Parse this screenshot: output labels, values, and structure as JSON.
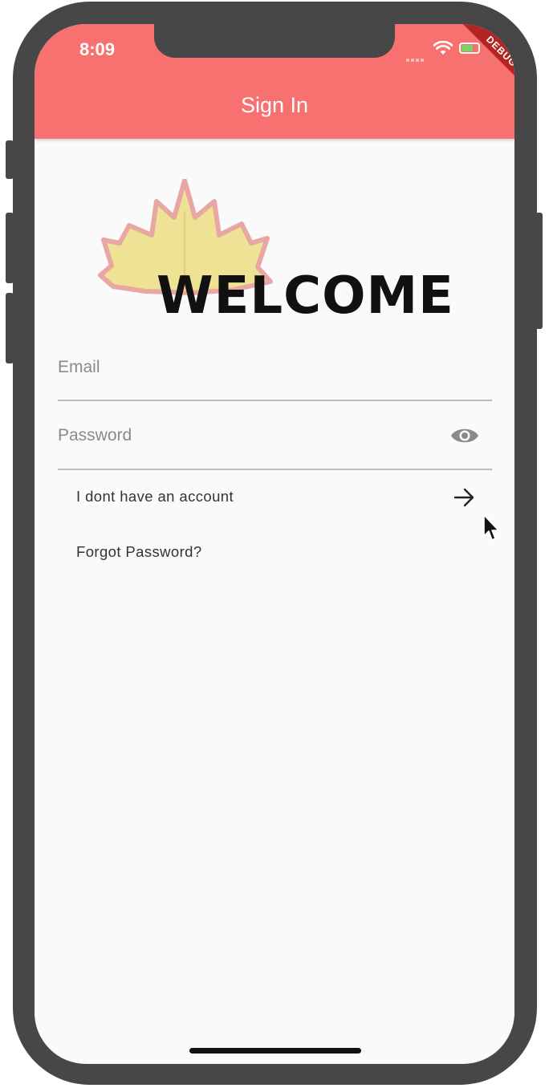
{
  "status_bar": {
    "time": "8:09",
    "debug_banner": "DEBUG",
    "battery_color": "#7ed166"
  },
  "app_bar": {
    "title": "Sign In",
    "color": "#f6716f"
  },
  "logo": {
    "icon": "maple-leaf-icon",
    "text": "WELCOME"
  },
  "form": {
    "email": {
      "placeholder": "Email",
      "value": ""
    },
    "password": {
      "placeholder": "Password",
      "value": "",
      "toggle_icon": "eye-icon"
    }
  },
  "links": {
    "no_account": "I dont have an account",
    "no_account_icon": "arrow-right-icon",
    "forgot_password": "Forgot Password?"
  }
}
